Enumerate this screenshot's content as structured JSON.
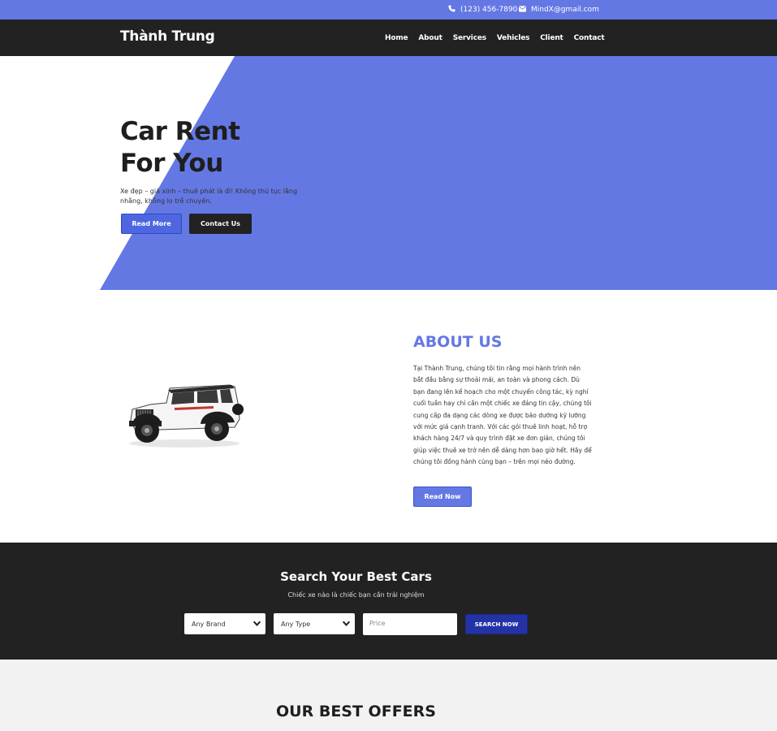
{
  "topbar": {
    "phone": "(123) 456-7890",
    "email": "MindX@gmail.com",
    "phone_icon": "phone-icon",
    "email_icon": "envelope-icon"
  },
  "nav": {
    "brand": "Thành Trung",
    "items": [
      "Home",
      "About",
      "Services",
      "Vehicles",
      "Client",
      "Contact"
    ]
  },
  "hero": {
    "title_line1": "Car Rent",
    "title_line2": "For You",
    "description": "Xe đẹp – giá xinh – thuê phát là đi! Không thủ tục lằng nhằng, không lo trễ chuyến.",
    "read_more": "Read More",
    "contact_us": "Contact Us"
  },
  "about": {
    "title": "ABOUT US",
    "text": "Tại Thành Trung, chúng tôi tin rằng mọi hành trình nên bắt đầu bằng sự thoải mái, an toàn và phong cách. Dù bạn đang lên kế hoạch cho một chuyến công tác, kỳ nghỉ cuối tuần hay chỉ cần một chiếc xe đáng tin cậy, chúng tôi cung cấp đa dạng các dòng xe được bảo dưỡng kỹ lưỡng với mức giá cạnh tranh. Với các gói thuê linh hoạt, hỗ trợ khách hàng 24/7 và quy trình đặt xe đơn giản, chúng tôi giúp việc thuê xe trở nên dễ dàng hơn bao giờ hết. Hãy để chúng tôi đồng hành cùng bạn – trên mọi nẻo đường.",
    "read_now": "Read Now",
    "image": "jeep-wrangler-image"
  },
  "search": {
    "title": "Search Your Best Cars",
    "subtitle": "Chiếc xe nào là chiếc bạn cần trải nghiệm",
    "brand_select": "Any Brand",
    "type_select": "Any Type",
    "price_placeholder": "Price",
    "button": "SEARCH NOW"
  },
  "offers": {
    "title": "OUR BEST OFFERS"
  },
  "colors": {
    "accent": "#6478e4",
    "dark": "#222222",
    "search_button": "#2333a6"
  }
}
